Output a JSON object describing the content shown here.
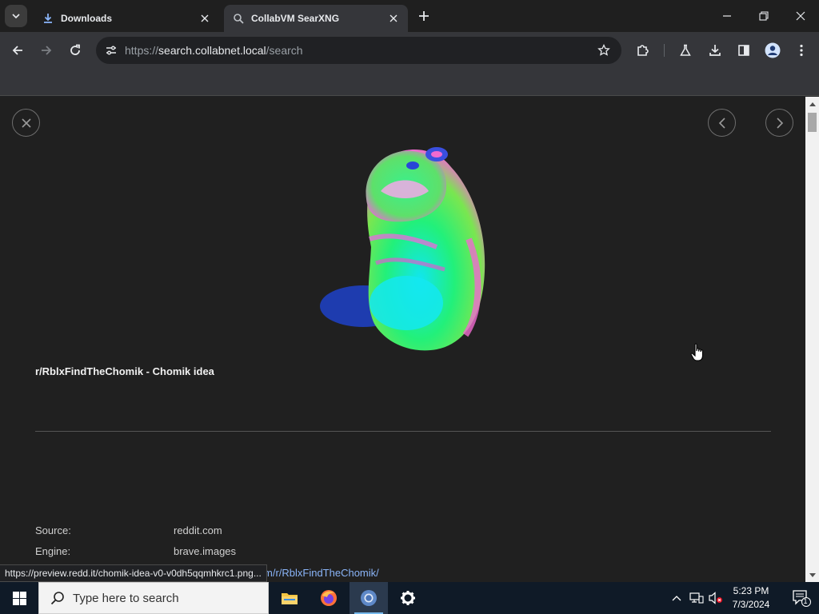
{
  "browser": {
    "tabs": [
      {
        "title": "Downloads",
        "active": false,
        "icon": "download-icon"
      },
      {
        "title": "CollabVM SearXNG",
        "active": true,
        "icon": "searxng-icon"
      }
    ],
    "url": {
      "scheme": "https://",
      "host": "search.collabnet.local",
      "path": "/search"
    }
  },
  "preview": {
    "title": "r/RblxFindTheChomik - Chomik idea",
    "meta": [
      {
        "label": "Source:",
        "value": "reddit.com"
      },
      {
        "label": "Engine:",
        "value": "brave.images"
      }
    ],
    "link_partial": "m/r/RblxFindTheChomik/",
    "status_url": "https://preview.redd.it/chomik-idea-v0-v0dh5qqmhkrc1.png..."
  },
  "taskbar": {
    "search_placeholder": "Type here to search",
    "time": "5:23 PM",
    "date": "7/3/2024",
    "notification_count": "1"
  },
  "colors": {
    "accent": "#8ab4f8",
    "taskbar": "#0f1a27"
  }
}
